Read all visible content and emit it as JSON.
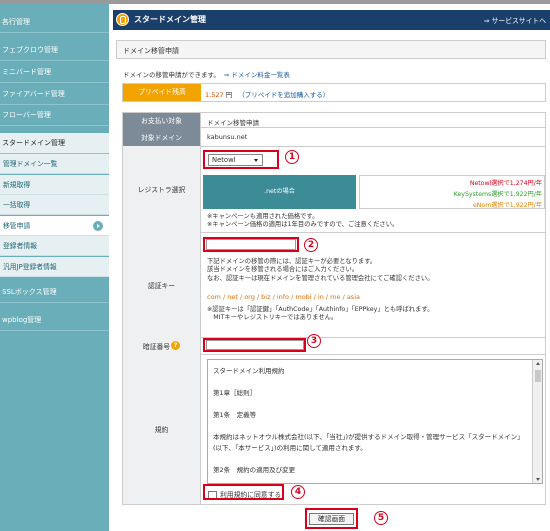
{
  "sidebar": {
    "items": [
      {
        "label": "各行管理"
      },
      {
        "label": "フェブクロウ管理"
      },
      {
        "label": "ミニバード管理"
      },
      {
        "label": "ファイアバード管理"
      },
      {
        "label": "フローバー管理"
      },
      {
        "label": "スタードメイン管理"
      }
    ],
    "sub_items": [
      {
        "label": "管理ドメイン一覧"
      },
      {
        "label": "新規取得"
      },
      {
        "label": "一括取得"
      },
      {
        "label": "移管申請"
      },
      {
        "label": "登録者情報"
      },
      {
        "label": "汎用JP登録者情報"
      }
    ],
    "bottom_items": [
      {
        "label": "SSLボックス管理"
      },
      {
        "label": "wpblog管理"
      }
    ]
  },
  "header": {
    "title": "スタードメイン管理",
    "link": "⇒ サービスサイトへ"
  },
  "section_title": "ドメイン移管申請",
  "intro": {
    "text": "ドメインの移管申請ができます。",
    "link": "⇒ ドメイン料金一覧表"
  },
  "prepaid": {
    "label": "プリペイド残高",
    "amount": "1,527",
    "unit": "円",
    "link": "（プリペイドを追加購入する）"
  },
  "form": {
    "payment_label": "お支払い対象",
    "payment_value": "ドメイン移管申請",
    "domain_label": "対象ドメイン",
    "domain_value": "kabunsu.net",
    "registrar_label": "レジストラ選択",
    "registrar_selected": "Netowl",
    "tld_banner": ".netの場合",
    "prices": [
      {
        "name": "Netowl",
        "text": "選択で1,274円/年"
      },
      {
        "name": "KeySystems",
        "text": "選択で1,922円/年"
      },
      {
        "name": "eNom",
        "text": "選択で1,922円/年"
      }
    ],
    "campaign_notes": [
      "※キャンペーンも適用された価格です。",
      "※キャンペーン価格の適用は1年目のみですので、ご注意ください。"
    ],
    "auth_label": "認証キー",
    "auth_notes": [
      "下記ドメインの移管の際には、認証キーが必要となります。",
      "該当ドメインを移管される場合にはご入力ください。",
      "なお、認証キーは現在ドメインを管理されている管理会社にてご確認ください。"
    ],
    "tld_list": "com / net / org / biz / info / mobi / in / me / asia",
    "auth_alt_notes": [
      "※認証キーは「認証鍵」「AuthCode」「Authinfo」「EPPkey」とも呼ばれます。",
      "　MITキーやレジストリキーではありません。"
    ],
    "captcha_label": "暗証番号",
    "captcha_help": "?",
    "terms_label": "規約",
    "terms_text": "スタードメイン利用規約\n\n第1章［総則］\n\n第1条　定義等\n\n本規約はネットオウル株式会社(以下、「当社」)が提供するドメイン取得・管理サービス「スタードメイン」(以下、「本サービス」)の利用に関して適用されます。\n\n第2条　規約の適用及び変更",
    "agree_label": "利用規約に同意する",
    "confirm_button": "確認画面"
  },
  "callouts": [
    "1",
    "2",
    "3",
    "4",
    "5"
  ],
  "colors": {
    "sidebar_bg": "#6aaeb9",
    "header_bg": "#1b3f6b",
    "prepaid_orange": "#f3a300",
    "callout_red": "#d9001b",
    "banner_teal": "#3c8c98"
  }
}
